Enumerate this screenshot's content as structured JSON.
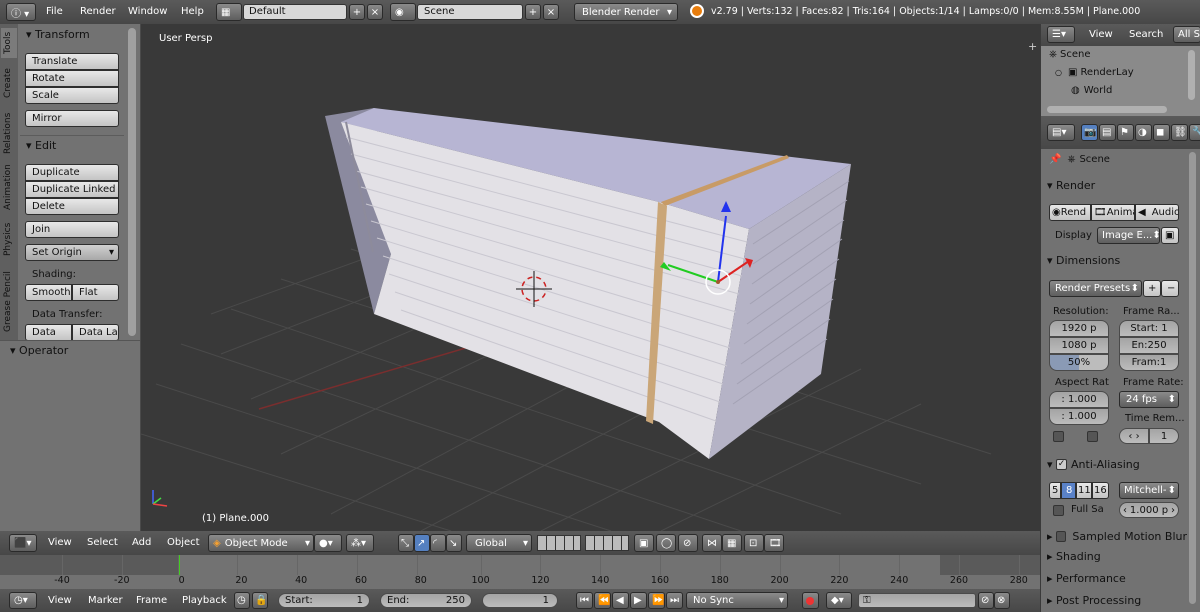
{
  "topbar": {
    "menus": [
      "File",
      "Render",
      "Window",
      "Help"
    ],
    "layout": "Default",
    "scene": "Scene",
    "engine": "Blender Render",
    "stats": "v2.79 | Verts:132 | Faces:82 | Tris:164 | Objects:1/14 | Lamps:0/0 | Mem:8.55M | Plane.000"
  },
  "toolshelf": {
    "tabs": [
      "Tools",
      "Create",
      "Relations",
      "Animation",
      "Physics",
      "Grease Pencil"
    ],
    "transform": {
      "title": "Transform",
      "buttons": [
        "Translate",
        "Rotate",
        "Scale",
        "Mirror"
      ]
    },
    "edit": {
      "title": "Edit",
      "buttons": [
        "Duplicate",
        "Duplicate Linked",
        "Delete",
        "Join"
      ],
      "set_origin": "Set Origin",
      "shading_label": "Shading:",
      "smooth": "Smooth",
      "flat": "Flat",
      "data_transfer_label": "Data Transfer:",
      "data": "Data",
      "data_la": "Data La"
    },
    "operator": "Operator"
  },
  "viewport": {
    "view_label": "User Persp",
    "object_label": "(1) Plane.000"
  },
  "viewheader": {
    "view": "View",
    "select": "Select",
    "add": "Add",
    "object": "Object",
    "mode": "Object Mode",
    "orientation": "Global"
  },
  "timeline": {
    "ticks": [
      "-40",
      "-20",
      "0",
      "20",
      "40",
      "60",
      "80",
      "100",
      "120",
      "140",
      "160",
      "180",
      "200",
      "220",
      "240",
      "260",
      "280"
    ],
    "view": "View",
    "marker": "Marker",
    "frame": "Frame",
    "playback": "Playback",
    "start": "Start:",
    "start_val": "1",
    "end": "End:",
    "end_val": "250",
    "current": "1",
    "sync": "No Sync"
  },
  "outliner": {
    "view": "View",
    "search": "Search",
    "all": "All Sc",
    "items": [
      "Scene",
      "RenderLay",
      "World"
    ]
  },
  "properties": {
    "scene": "Scene",
    "render": {
      "title": "Render",
      "rend": "Rend",
      "anim": "Anima",
      "audio": "Audio",
      "display_label": "Display",
      "display_val": "Image E..."
    },
    "dimensions": {
      "title": "Dimensions",
      "presets": "Render Presets",
      "resolution_label": "Resolution:",
      "res_x": "1920 p",
      "res_y": "1080 p",
      "res_pct": "50%",
      "frame_range_label": "Frame Ra...",
      "start": "Start: 1",
      "end": "En:250",
      "step": "Fram:1",
      "aspect_label": "Aspect Rat",
      "aspect_x": ": 1.000",
      "aspect_y": ": 1.000",
      "frame_rate_label": "Frame Rate:",
      "fps": "24 fps",
      "time_rem": "Time Rem...",
      "time_val": "1"
    },
    "aa": {
      "title": "Anti-Aliasing",
      "samples": [
        "5",
        "8",
        "11",
        "16"
      ],
      "filter": "Mitchell-",
      "full": "Full Sa",
      "size": "1.000 p"
    },
    "motion_blur": "Sampled Motion Blur",
    "shading": "Shading",
    "performance": "Performance",
    "post": "Post Processing"
  }
}
